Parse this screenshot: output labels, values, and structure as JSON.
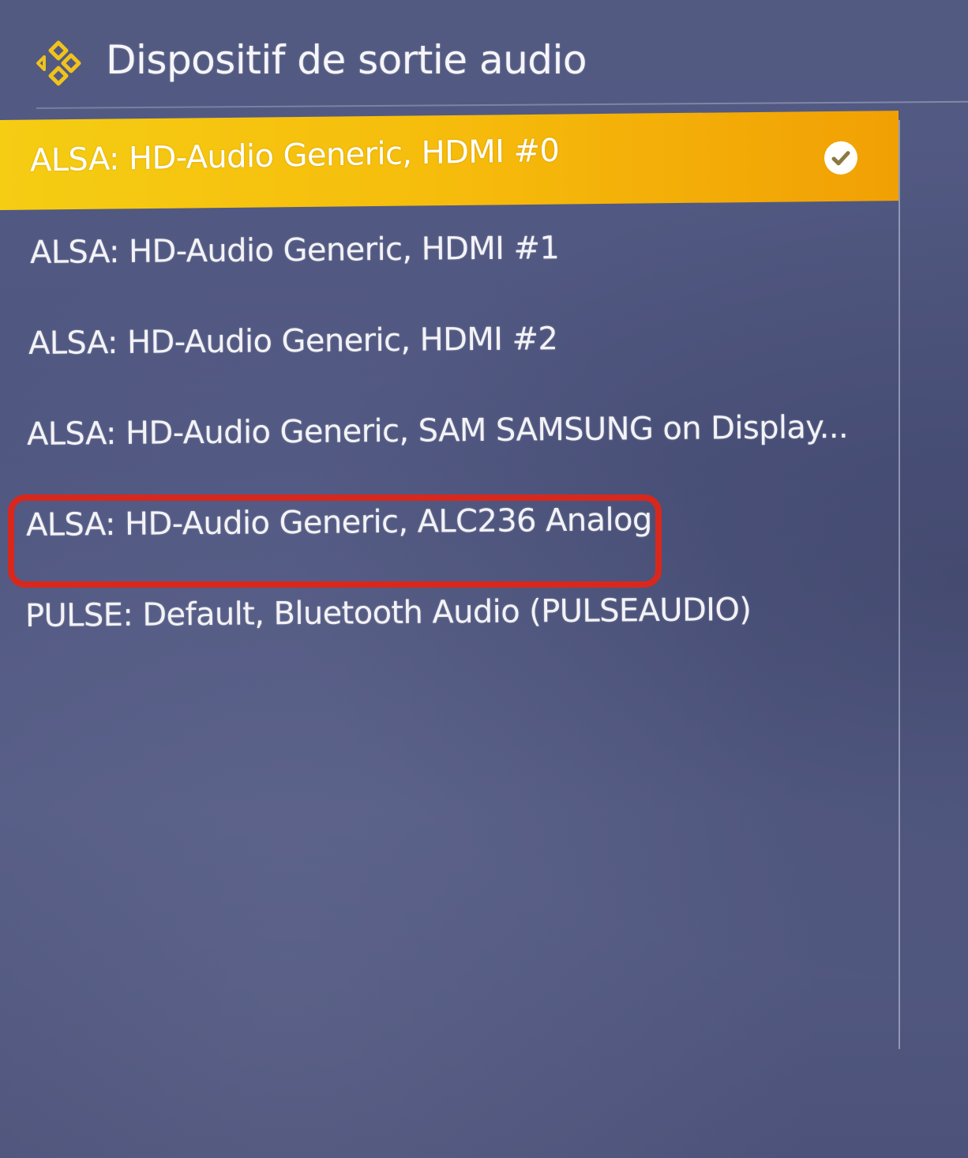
{
  "dialog": {
    "title": "Dispositif de sortie audio",
    "logo_icon": "kodi-logo-icon"
  },
  "devices": [
    {
      "label": "ALSA: HD-Audio Generic, HDMI #0",
      "selected": true
    },
    {
      "label": "ALSA: HD-Audio Generic, HDMI #1",
      "selected": false
    },
    {
      "label": "ALSA: HD-Audio Generic, HDMI #2",
      "selected": false
    },
    {
      "label": "ALSA: HD-Audio Generic, SAM SAMSUNG on Display...",
      "selected": false
    },
    {
      "label": "ALSA: HD-Audio Generic, ALC236 Analog",
      "selected": false,
      "annotated": true
    },
    {
      "label": "PULSE: Default, Bluetooth Audio (PULSEAUDIO)",
      "selected": false
    }
  ],
  "colors": {
    "background": "#535a82",
    "selection": "#f5c30f",
    "annotation_outline": "#d8281d",
    "logo": "#f0c21c"
  },
  "selected_indicator_icon": "checkmark-circle-icon"
}
